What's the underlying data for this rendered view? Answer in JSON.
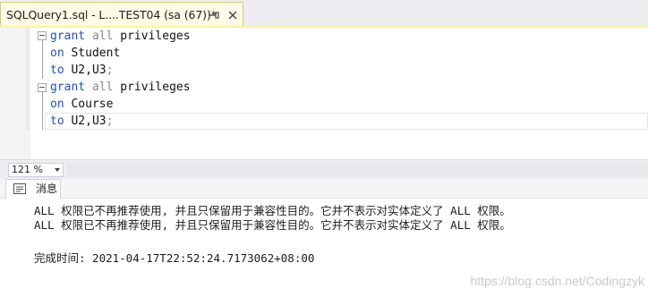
{
  "tab": {
    "title": "SQLQuery1.sql - L....TEST04 (sa (67))*"
  },
  "editor": {
    "blocks": [
      {
        "line1": {
          "keyword": "grant",
          "mid": " all ",
          "tail": "privileges"
        },
        "line2": {
          "keyword": "on",
          "object": " Student"
        },
        "line3": {
          "keyword": "to",
          "users": " U2,U3",
          "semicolon": ";"
        }
      },
      {
        "line1": {
          "keyword": "grant",
          "mid": " all ",
          "tail": "privileges"
        },
        "line2": {
          "keyword": "on",
          "object": " Course"
        },
        "line3": {
          "keyword": "to",
          "users": " U2,U3",
          "semicolon": ";"
        }
      }
    ]
  },
  "zoom": {
    "value": "121 %"
  },
  "results": {
    "tab_label": "消息",
    "messages": [
      "ALL 权限已不再推荐使用, 并且只保留用于兼容性目的。它并不表示对实体定义了 ALL 权限。",
      "ALL 权限已不再推荐使用, 并且只保留用于兼容性目的。它并不表示对实体定义了 ALL 权限。"
    ],
    "completion": "完成时间: 2021-04-17T22:52:24.7173062+08:00"
  },
  "watermark": "https://blog.csdn.net/Codingzyk",
  "colors": {
    "keyword": "#1e50c8",
    "tab_active": "#fffbe6",
    "tab_underline": "#fff29d"
  }
}
